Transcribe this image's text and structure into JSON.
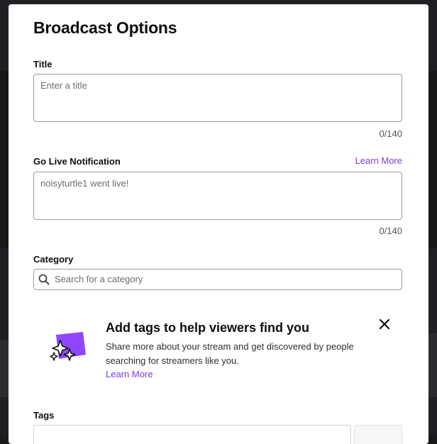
{
  "modal": {
    "title": "Broadcast Options"
  },
  "title_field": {
    "label": "Title",
    "placeholder": "Enter a title",
    "counter": "0/140"
  },
  "notification_field": {
    "label": "Go Live Notification",
    "learn_more": "Learn More",
    "placeholder": "noisyturtle1 went live!",
    "counter": "0/140"
  },
  "category_field": {
    "label": "Category",
    "placeholder": "Search for a category",
    "icon": "search-icon"
  },
  "tags_promo": {
    "title": "Add tags to help viewers find you",
    "text": "Share more about your stream and get discovered by people searching for streamers like you.",
    "learn_more": "Learn More",
    "close_icon": "close-icon",
    "art_icon": "sparkle-tag-icon",
    "accent_color": "#9147ff"
  },
  "tags_field": {
    "label": "Tags"
  },
  "colors": {
    "link": "#7c3ae0",
    "text": "#0e0e10",
    "border": "#9a9aa0"
  }
}
